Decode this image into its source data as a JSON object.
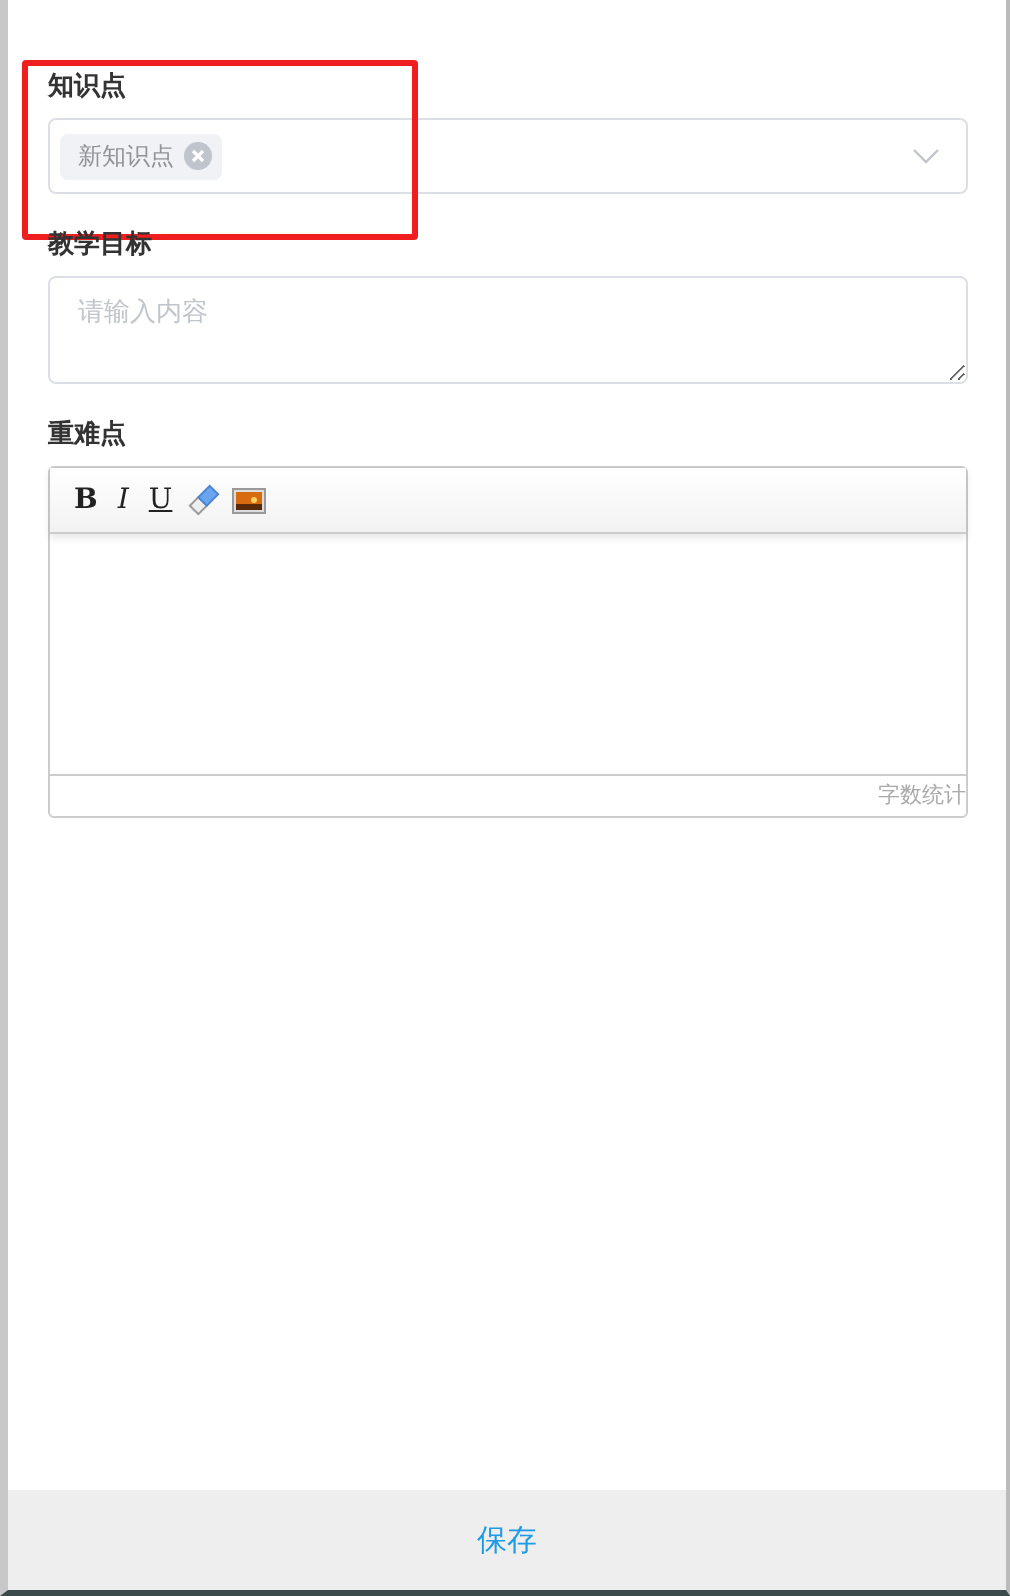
{
  "fields": [
    {
      "kind": "tags",
      "label": "知识点",
      "tags": [
        "新知识点"
      ],
      "highlighted": true
    },
    {
      "kind": "textarea",
      "label": "教学目标",
      "placeholder": "请输入内容",
      "highlighted": false
    },
    {
      "kind": "editor",
      "label": "重难点",
      "tools": [
        {
          "kind": "bold",
          "label": "B"
        },
        {
          "kind": "italic",
          "label": "I"
        },
        {
          "kind": "underline",
          "label": "U"
        },
        {
          "kind": "eraser"
        },
        {
          "kind": "image"
        }
      ],
      "counter": "字数统计",
      "highlighted": false
    }
  ],
  "footer": {
    "button": "保存"
  }
}
